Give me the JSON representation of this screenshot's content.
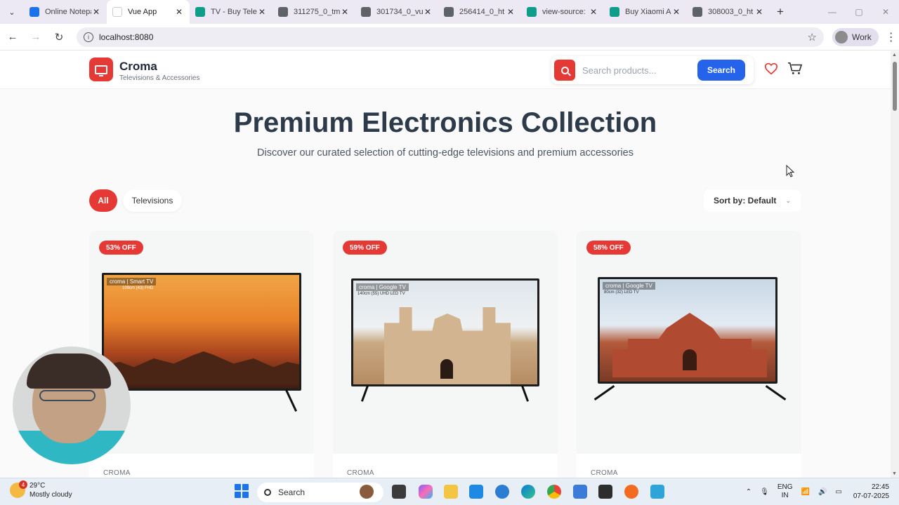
{
  "browser": {
    "tabs": [
      {
        "label": "Online Notepad",
        "favicon_color": "#1a73e8",
        "active": false
      },
      {
        "label": "Vue App",
        "favicon_color": "#ffffff",
        "active": true
      },
      {
        "label": "TV - Buy Televisions",
        "favicon_color": "#0f9d8a",
        "active": false
      },
      {
        "label": "311275_0_tm",
        "favicon_color": "#5f6368",
        "active": false
      },
      {
        "label": "301734_0_vu",
        "favicon_color": "#5f6368",
        "active": false
      },
      {
        "label": "256414_0_ht",
        "favicon_color": "#5f6368",
        "active": false
      },
      {
        "label": "view-source:",
        "favicon_color": "#0f9d8a",
        "active": false
      },
      {
        "label": "Buy Xiaomi A",
        "favicon_color": "#0f9d8a",
        "active": false
      },
      {
        "label": "308003_0_ht",
        "favicon_color": "#5f6368",
        "active": false
      }
    ],
    "url": "localhost:8080",
    "profile": "Work"
  },
  "header": {
    "brand_name": "Croma",
    "brand_tagline": "Televisions & Accessories",
    "search_placeholder": "Search products...",
    "search_button": "Search"
  },
  "hero": {
    "title": "Premium Electronics Collection",
    "subtitle": "Discover our curated selection of cutting-edge televisions and premium accessories"
  },
  "filters": {
    "all": "All",
    "televisions": "Televisions",
    "sort": "Sort by: Default"
  },
  "products": [
    {
      "discount": "53% OFF",
      "brand": "CROMA",
      "screen_top": "croma | Smart TV",
      "screen_sub": "109cm (43) FHD"
    },
    {
      "discount": "59% OFF",
      "brand": "CROMA",
      "screen_top": "croma | Google TV",
      "screen_sub": "140cm (55) UHD LED TV"
    },
    {
      "discount": "58% OFF",
      "brand": "CROMA",
      "screen_top": "croma | Google TV",
      "screen_sub": "80cm (32) LED TV"
    }
  ],
  "taskbar": {
    "temperature": "29°C",
    "weather": "Mostly cloudy",
    "weather_badge": "4",
    "search": "Search",
    "lang_top": "ENG",
    "lang_bottom": "IN",
    "time": "22:45",
    "date": "07-07-2025"
  }
}
